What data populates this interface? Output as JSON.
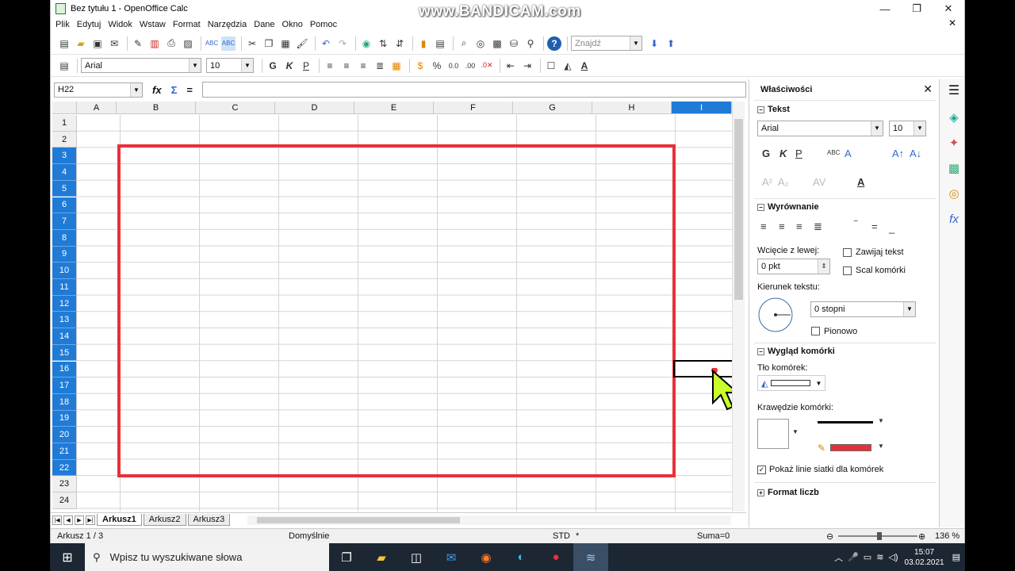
{
  "window": {
    "title": "Bez tytułu 1 - OpenOffice Calc",
    "watermark": "www.BANDICAM.com",
    "min": "—",
    "max": "❐",
    "close": "✕"
  },
  "menu": [
    "Plik",
    "Edytuj",
    "Widok",
    "Wstaw",
    "Format",
    "Narzędzia",
    "Dane",
    "Okno",
    "Pomoc"
  ],
  "toolbar": {
    "find_placeholder": "Znajdź",
    "font": "Arial",
    "size": "10",
    "bold": "G",
    "italic": "K",
    "underline": "P"
  },
  "formula": {
    "cell_ref": "H22",
    "fx": "fx",
    "sum": "Σ",
    "eq": "="
  },
  "columns": [
    "A",
    "B",
    "C",
    "D",
    "E",
    "F",
    "G",
    "H",
    "I"
  ],
  "rows": [
    "1",
    "2",
    "3",
    "4",
    "5",
    "6",
    "7",
    "8",
    "9",
    "10",
    "11",
    "12",
    "13",
    "14",
    "15",
    "16",
    "17",
    "18",
    "19",
    "20",
    "21",
    "22",
    "23",
    "24"
  ],
  "sheets": {
    "tabs": [
      "Arkusz1",
      "Arkusz2",
      "Arkusz3"
    ]
  },
  "status": {
    "sheet": "Arkusz 1 / 3",
    "style": "Domyślnie",
    "mode": "STD",
    "mod": "*",
    "sum": "Suma=0",
    "zoom": "136 %"
  },
  "sidebar": {
    "title": "Właściwości",
    "text_section": "Tekst",
    "font": "Arial",
    "size": "10",
    "bold": "G",
    "italic": "K",
    "underline": "P",
    "align_section": "Wyrównanie",
    "indent_label": "Wcięcie z lewej:",
    "indent_value": "0 pkt",
    "wrap_label": "Zawijaj tekst",
    "merge_label": "Scal komórki",
    "direction_label": "Kierunek tekstu:",
    "degrees": "0 stopni",
    "vertical_label": "Pionowo",
    "cell_section": "Wygląd komórki",
    "bg_label": "Tło komórek:",
    "borders_label": "Krawędzie komórki:",
    "gridlines_label": "Pokaż linie siatki dla komórek",
    "number_section": "Format liczb"
  },
  "taskbar": {
    "search_placeholder": "Wpisz tu wyszukiwane słowa",
    "time": "15:07",
    "date": "03.02.2021"
  }
}
